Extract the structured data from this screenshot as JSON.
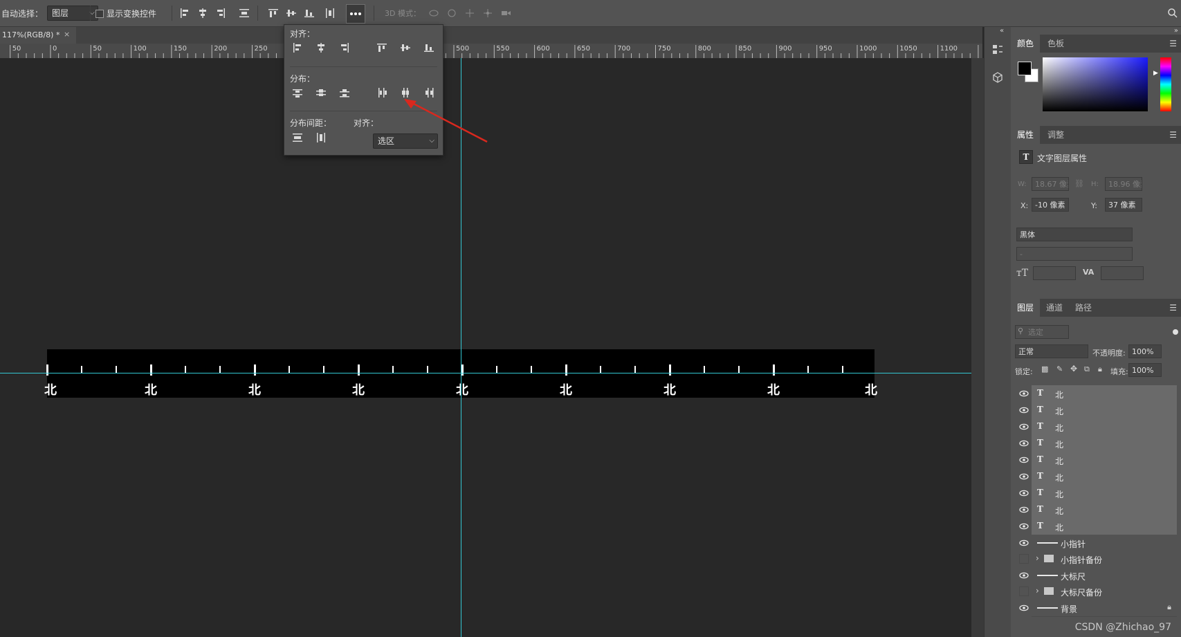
{
  "optionsbar": {
    "auto_select_label": "自动选择：",
    "auto_select_value": "图层",
    "show_transform_label": "显示变换控件",
    "mode_3d_label": "3D 模式："
  },
  "document": {
    "tab_title": "117%(RGB/8) *",
    "close_glyph": "×"
  },
  "ruler": {
    "labels": [
      "50",
      "0",
      "50",
      "100",
      "150",
      "200",
      "250",
      "300",
      "350",
      "400",
      "450",
      "500",
      "550",
      "600",
      "650",
      "700",
      "750",
      "800",
      "850",
      "900",
      "950",
      "1000",
      "1050",
      "1100"
    ]
  },
  "align_popup": {
    "align_label": "对齐：",
    "distribute_label": "分布：",
    "spacing_label": "分布间距：",
    "align_to_label": "对齐：",
    "align_to_value": "选区"
  },
  "canvas": {
    "tick_labels": [
      "北",
      "北",
      "北",
      "北",
      "北",
      "北",
      "北"
    ],
    "edge_left": "北",
    "edge_right": "北"
  },
  "colors": {
    "guide": "#33c8d4",
    "panel": "#535353",
    "canvas": "#282828",
    "arrow": "#d9281e"
  },
  "panels": {
    "color_tabs": [
      "颜色",
      "色板"
    ],
    "props_tabs": [
      "属性",
      "调整"
    ],
    "props_title": "文字图层属性",
    "w_label": "W:",
    "w_value": "18.67 像素",
    "h_label": "H:",
    "h_value": "18.96 像素",
    "x_label": "X:",
    "x_value": "-10 像素",
    "y_label": "Y:",
    "y_value": "37 像素",
    "font_family": "黑体",
    "font_style": "-",
    "layers_tabs": [
      "图层",
      "通道",
      "路径"
    ],
    "filter_placeholder": "选定",
    "blend_mode": "正常",
    "opacity_label": "不透明度:",
    "opacity_value": "100%",
    "lock_label": "锁定:",
    "fill_label": "填充:",
    "fill_value": "100%",
    "layers": [
      {
        "name": "北",
        "type": "text",
        "visible": true
      },
      {
        "name": "北",
        "type": "text",
        "visible": true
      },
      {
        "name": "北",
        "type": "text",
        "visible": true
      },
      {
        "name": "北",
        "type": "text",
        "visible": true
      },
      {
        "name": "北",
        "type": "text",
        "visible": true
      },
      {
        "name": "北",
        "type": "text",
        "visible": true
      },
      {
        "name": "北",
        "type": "text",
        "visible": true
      },
      {
        "name": "北",
        "type": "text",
        "visible": true
      },
      {
        "name": "北",
        "type": "text",
        "visible": true
      },
      {
        "name": "小指针",
        "type": "shape",
        "visible": true
      },
      {
        "name": "小指针备份",
        "type": "group",
        "visible": false
      },
      {
        "name": "大标尺",
        "type": "shape",
        "visible": true
      },
      {
        "name": "大标尺备份",
        "type": "group",
        "visible": false
      },
      {
        "name": "背景",
        "type": "shape",
        "visible": true
      }
    ]
  },
  "watermark": "CSDN @Zhichao_97"
}
